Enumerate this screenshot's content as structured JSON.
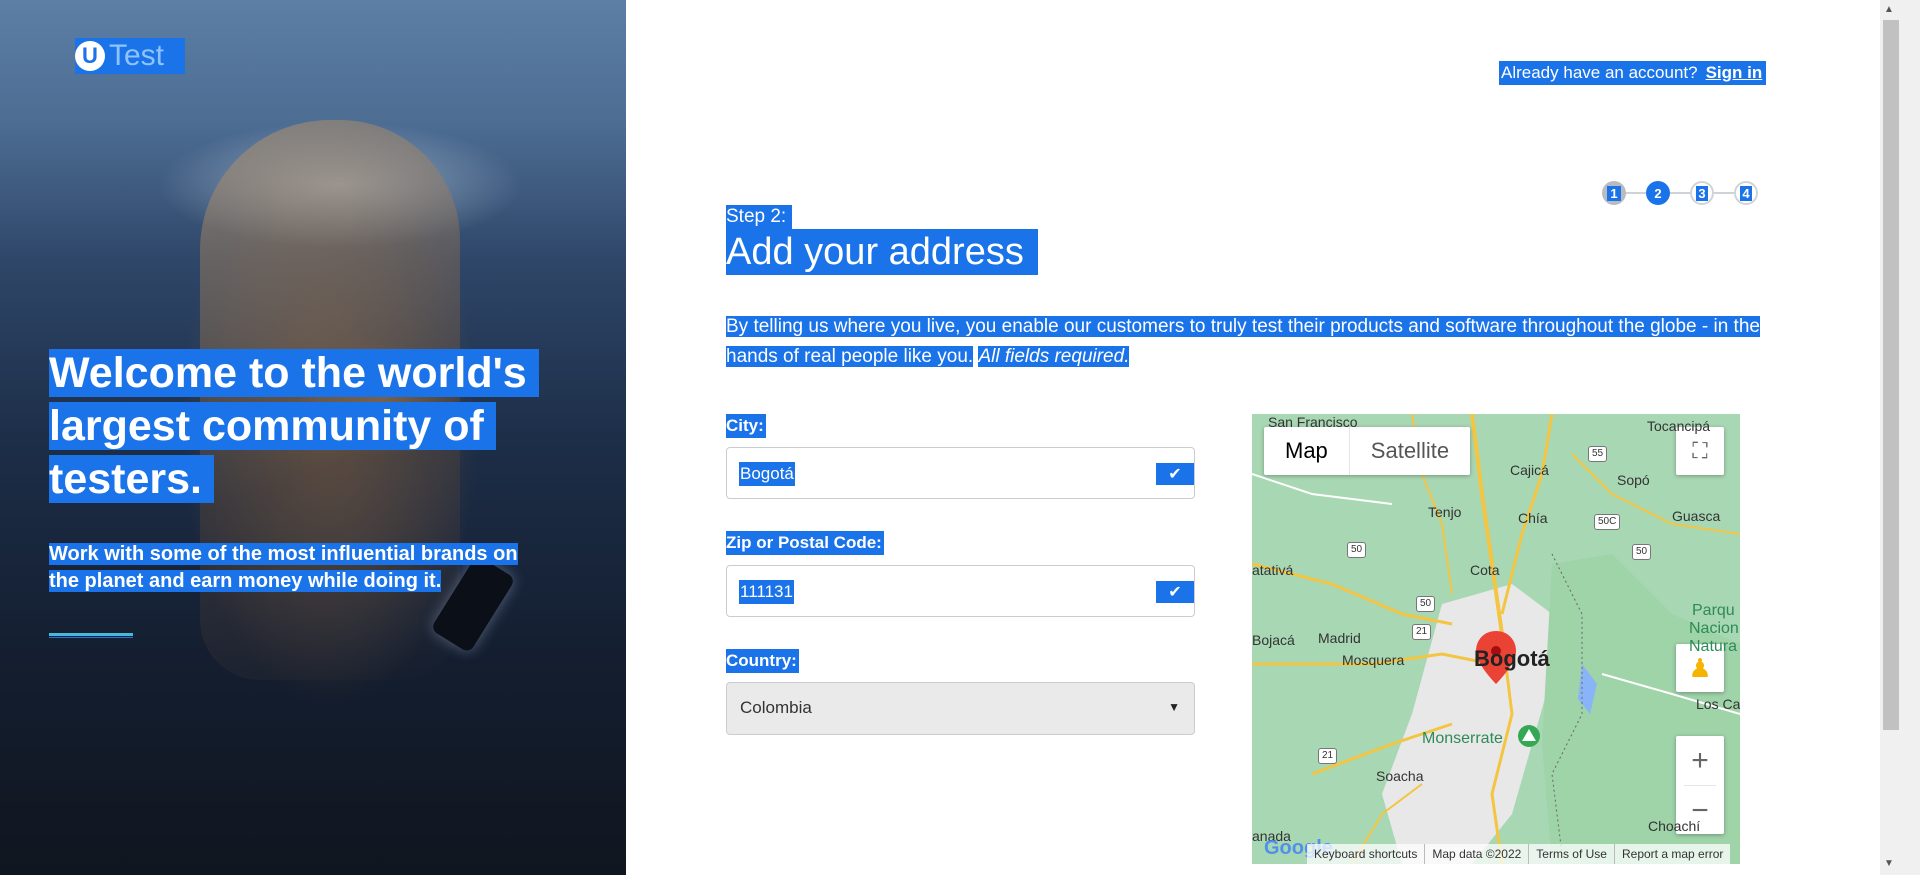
{
  "hero": {
    "logo_text": "Test",
    "logo_letter": "U",
    "title_lines": [
      "Welcome to the world's",
      "largest community of",
      "testers."
    ],
    "subtitle_lines": [
      "Work with some of the most influential brands on",
      "the planet and earn money while doing it."
    ]
  },
  "header": {
    "already_text": "Already have an account?",
    "sign_in_label": "Sign in"
  },
  "stepper": {
    "steps": [
      "1",
      "2",
      "3",
      "4"
    ],
    "current": 2
  },
  "form": {
    "step_label": "Step 2:",
    "title": "Add your address",
    "description": "By telling us where you live, you enable our customers to truly test their products and software throughout the globe - in the hands of real people like you.",
    "description_emphasis": "All fields required.",
    "city_label": "City:",
    "city_value": "Bogotá",
    "zip_label": "Zip or Postal Code:",
    "zip_value": "111131",
    "country_label": "Country:",
    "country_value": "Colombia"
  },
  "map": {
    "type_map": "Map",
    "type_satellite": "Satellite",
    "places": {
      "san_francisco": "San Francisco",
      "tocancipa": "Tocancipá",
      "cajica": "Cajicá",
      "sopo": "Sopó",
      "tenjo": "Tenjo",
      "chia": "Chía",
      "guasca": "Guasca",
      "facatativa": "atativá",
      "cota": "Cota",
      "bojaca": "Bojacá",
      "madrid": "Madrid",
      "mosquera": "Mosquera",
      "bogota": "Bogotá",
      "parque": "Parqu",
      "nacion": "Nacion",
      "natural": "Natura",
      "los_cal": "Los Cal",
      "monserrate": "Monserrate",
      "soacha": "Soacha",
      "choachi": "Choachí",
      "granada": "anada"
    },
    "shields": [
      "55",
      "50C",
      "50",
      "50",
      "21",
      "50",
      "21"
    ],
    "google_label": "Google",
    "footer": [
      "Keyboard shortcuts",
      "Map data ©2022",
      "Terms of Use",
      "Report a map error"
    ]
  },
  "colors": {
    "selection": "#1a73e8",
    "accent_line": "#4ab9d9",
    "map_green": "#a8d7b3",
    "pin": "#ea4335"
  }
}
